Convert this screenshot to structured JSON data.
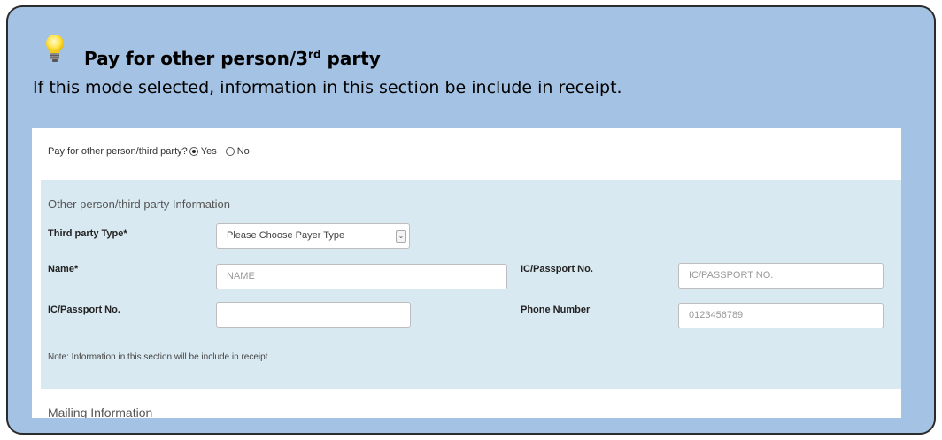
{
  "callout": {
    "heading_main": "Pay for other person/3",
    "heading_sup": "rd",
    "heading_tail": " party",
    "subtext": "If this mode selected, information in this section be include in receipt."
  },
  "question": {
    "label": "Pay for other person/third party?",
    "options": [
      {
        "label": "Yes",
        "selected": true
      },
      {
        "label": "No",
        "selected": false
      }
    ]
  },
  "third_party": {
    "section_title": "Other person/third party Information",
    "type_label": "Third party Type*",
    "type_select": {
      "value": "Please Choose Payer Type"
    },
    "name_label": "Name*",
    "name_placeholder": "NAME",
    "ic_passport_label_right": "IC/Passport No.",
    "ic_passport_placeholder_right": "IC/PASSPORT NO.",
    "ic_passport_label_left": "IC/Passport No.",
    "ic_passport_value_left": "",
    "phone_label": "Phone Number",
    "phone_placeholder": "0123456789",
    "note": "Note: Information in this section will be include in receipt"
  },
  "mailing": {
    "section_title": "Mailing Information"
  },
  "colors": {
    "callout_bg": "#a4c2e3",
    "info_bg": "#d9e9f1",
    "border": "#2b2b2b"
  }
}
